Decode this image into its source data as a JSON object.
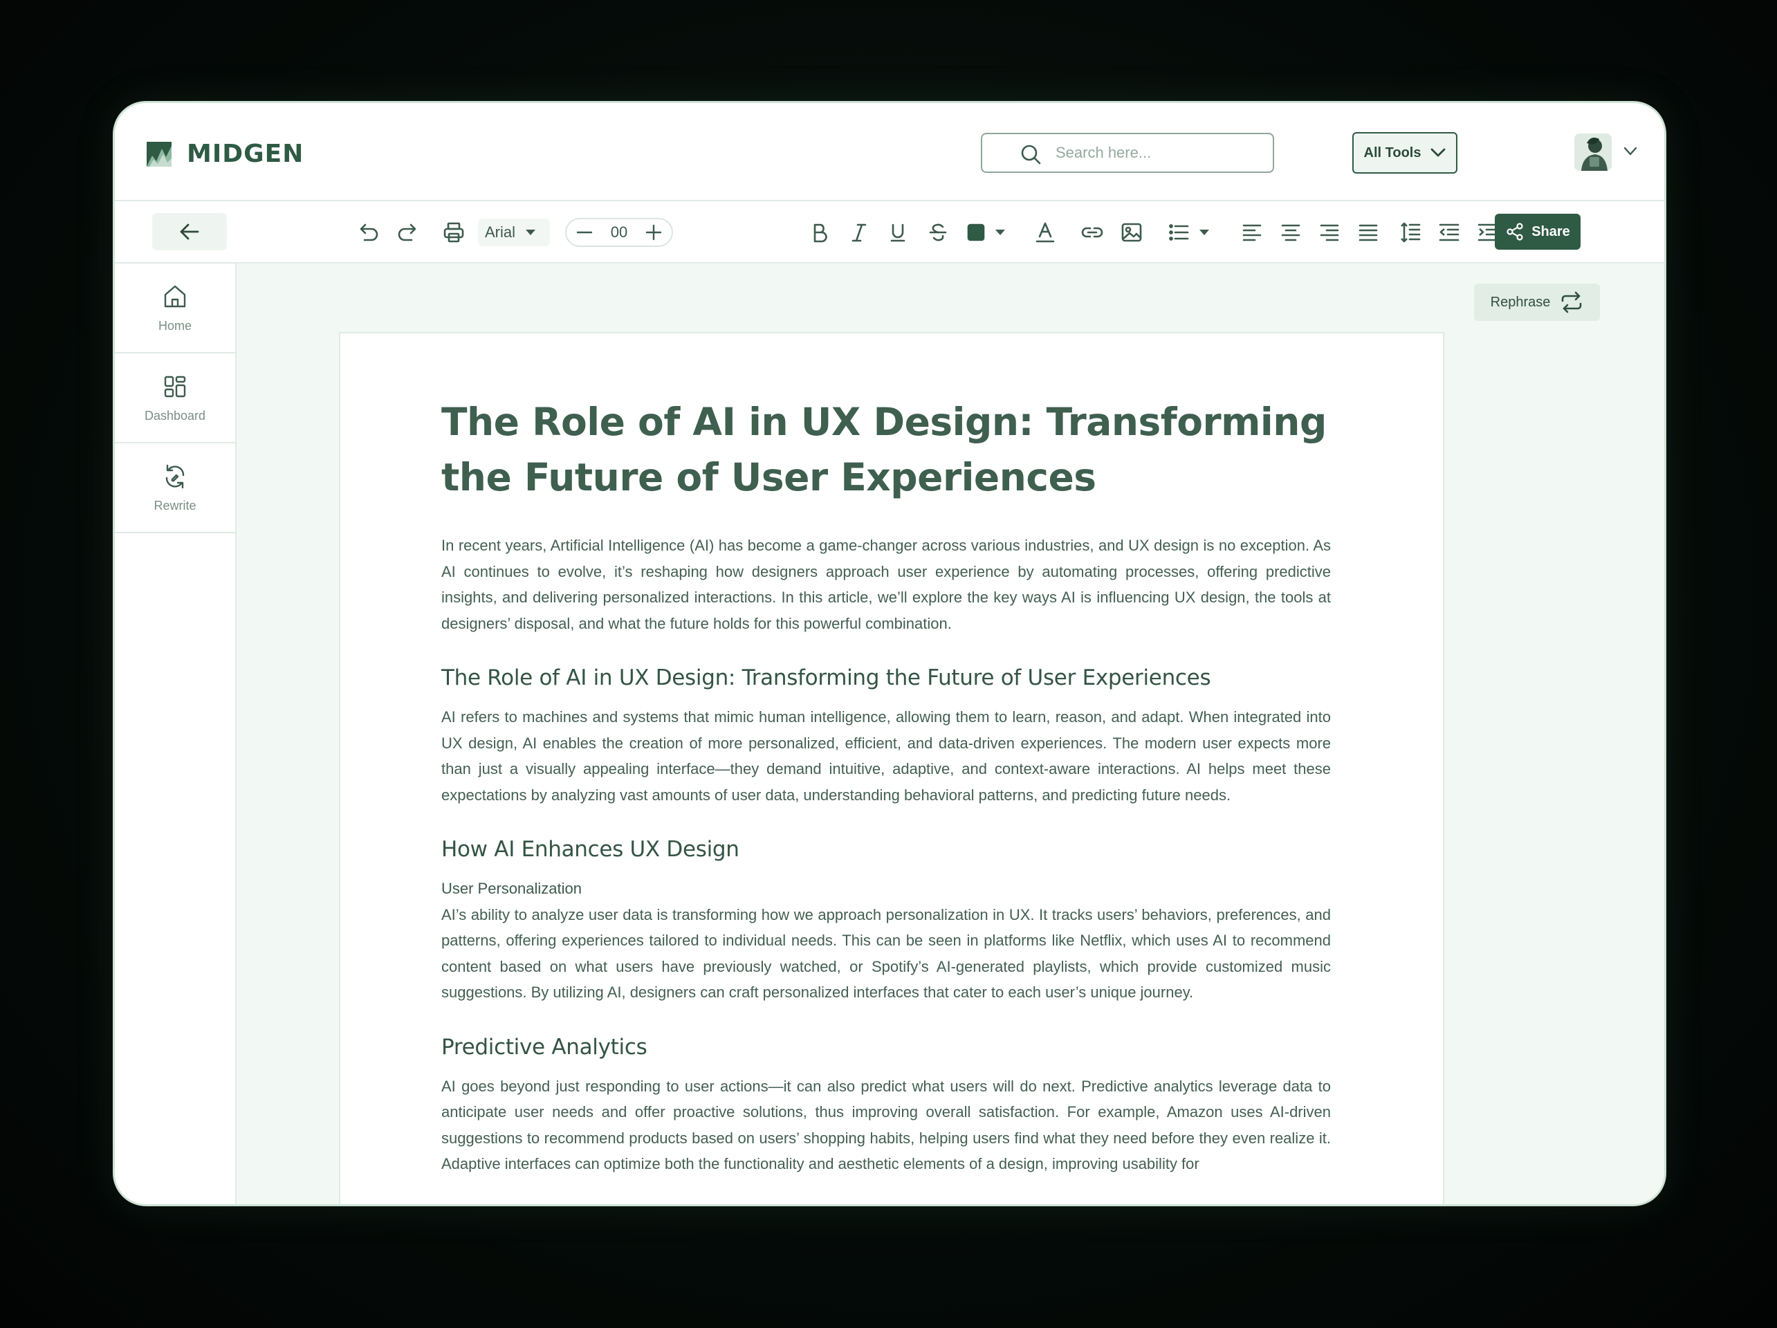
{
  "brand": {
    "name": "MIDGEN"
  },
  "search": {
    "placeholder": "Search here..."
  },
  "tools_dropdown": {
    "label": "All Tools"
  },
  "toolbar": {
    "font_family": "Arial",
    "font_size": "00",
    "share_label": "Share",
    "icons": [
      "undo-icon",
      "redo-icon",
      "print-icon",
      "bold-icon",
      "italic-icon",
      "underline-icon",
      "strikethrough-icon",
      "fill-color-icon",
      "text-color-icon",
      "link-icon",
      "image-icon",
      "bullet-list-icon",
      "align-left-icon",
      "align-center-icon",
      "align-right-icon",
      "align-justify-icon",
      "line-spacing-icon",
      "outdent-icon",
      "indent-icon",
      "clear-format-icon"
    ],
    "fill_color": "#2f5a44"
  },
  "sidebar": {
    "items": [
      {
        "label": "Home",
        "icon": "home-icon"
      },
      {
        "label": "Dashboard",
        "icon": "dashboard-icon"
      },
      {
        "label": "Rewrite",
        "icon": "rewrite-icon"
      }
    ]
  },
  "rephrase": {
    "label": "Rephrase"
  },
  "document": {
    "title": "The Role of AI in UX Design: Transforming the Future of User Experiences",
    "intro": "In recent years, Artificial Intelligence (AI) has become a game-changer across various industries, and UX design is no exception. As AI continues to evolve, it’s reshaping how designers approach user experience by automating processes, offering predictive insights, and delivering personalized interactions. In this article, we’ll explore the key ways AI is influencing UX design, the tools at designers’ disposal, and what the future holds for this powerful combination.",
    "section1_heading": "The Role of AI in UX Design: Transforming the Future of User Experiences",
    "section1_body": "AI refers to machines and systems that mimic human intelligence, allowing them to learn, reason, and adapt. When integrated into UX design, AI enables the creation of more personalized, efficient, and data-driven experiences. The modern user expects more than just a visually appealing interface—they demand intuitive, adaptive, and context-aware interactions. AI helps meet these expectations by analyzing vast amounts of user data, understanding behavioral patterns, and predicting future needs.",
    "section2_heading": "How AI Enhances UX Design",
    "section2_sub": "User Personalization",
    "section2_body": "AI’s ability to analyze user data is transforming how we approach personalization in UX. It tracks users’ behaviors, preferences, and patterns, offering experiences tailored to individual needs. This can be seen in platforms like Netflix, which uses AI to recommend content based on what users have previously watched, or Spotify’s AI-generated playlists, which provide customized music suggestions. By utilizing AI, designers can craft personalized interfaces that cater to each user’s unique journey.",
    "section3_heading": "Predictive Analytics",
    "section3_body": "AI goes beyond just responding to user actions—it can also predict what users will do next. Predictive analytics leverage data to anticipate user needs and offer proactive solutions, thus improving overall satisfaction. For example, Amazon uses AI-driven suggestions to recommend products based on users’ shopping habits, helping users find what they need before they even realize it. Adaptive interfaces can optimize both the functionality and aesthetic elements of a design, improving usability for"
  }
}
